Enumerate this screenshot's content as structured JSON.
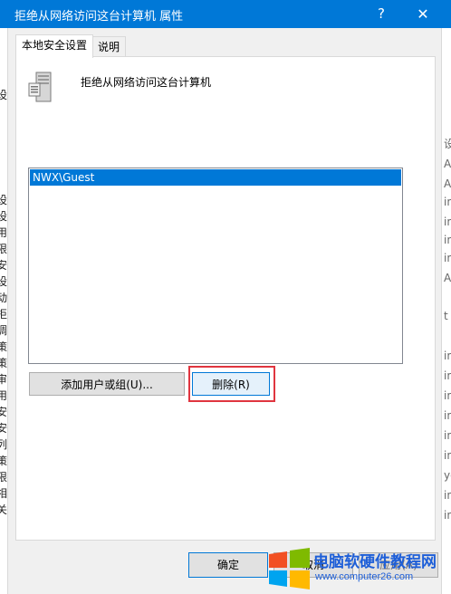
{
  "window": {
    "title": "拒绝从网络访问这台计算机 属性",
    "help_glyph": "?",
    "close_glyph": "✕"
  },
  "tabs": [
    {
      "label": "本地安全设置",
      "active": true
    },
    {
      "label": "说明",
      "active": false
    }
  ],
  "policy": {
    "icon": "server-policy-icon",
    "name": "拒绝从网络访问这台计算机"
  },
  "accounts": [
    {
      "name": "NWX\\Guest",
      "selected": true
    }
  ],
  "buttons": {
    "add": "添加用户或组(U)...",
    "remove": "删除(R)",
    "ok": "确定",
    "cancel": "取消",
    "apply": "应用(A)"
  },
  "watermark": {
    "brand": "电脑软硬件教程网",
    "url": "www.computer26.com"
  },
  "colors": {
    "accent": "#0078d7",
    "highlight_box": "#e0353f"
  },
  "background_fragments": {
    "left": [
      "设",
      "设",
      "设",
      "用",
      "限",
      "安",
      "设",
      "动",
      "拒",
      "调",
      "策",
      "策",
      "审",
      "用",
      "安",
      "安",
      "列",
      "策",
      "限",
      "相",
      "关"
    ],
    "right": [
      "设",
      "Al",
      "Al",
      "in",
      "in",
      "in",
      "in",
      "Al",
      "t",
      "in",
      "in",
      "in",
      "in",
      "in",
      "in",
      "yo",
      "in",
      "in"
    ]
  }
}
